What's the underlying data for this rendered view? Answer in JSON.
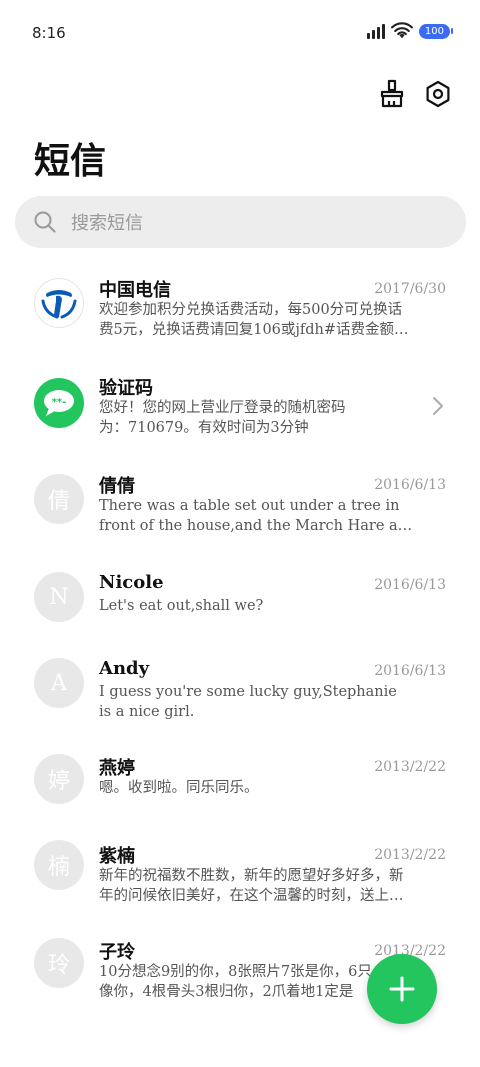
{
  "status_bar": {
    "time": "8:16",
    "battery": "100"
  },
  "header": {
    "title": "短信"
  },
  "search": {
    "placeholder": "搜索短信"
  },
  "messages": [
    {
      "name": "中国电信",
      "date": "2017/6/30",
      "line1": "欢迎参加积分兑换话费活动，每500分可兑换话",
      "line2": "费5元，兑换话费请回复106或jfdh#话费金额…",
      "avatar": "china-telecom-logo"
    },
    {
      "name": "验证码",
      "date": "",
      "line1": "您好！您的网上营业厅登录的随机密码",
      "line2": "为：710679。有效时间为3分钟",
      "avatar": "message-code-icon"
    },
    {
      "name": "倩倩",
      "date": "2016/6/13",
      "line1": "There was a table set out under a tree in",
      "line2": "front of the house,and the March Hare a…",
      "avatar_text": "倩"
    },
    {
      "name": "Nicole",
      "date": "2016/6/13",
      "line1": "Let's eat out,shall we?",
      "line2": "",
      "avatar_text": "N"
    },
    {
      "name": "Andy",
      "date": "2016/6/13",
      "line1": "I guess you're some lucky guy,Stephanie",
      "line2": "is a nice girl.",
      "avatar_text": "A"
    },
    {
      "name": "燕婷",
      "date": "2013/2/22",
      "line1": "嗯。收到啦。同乐同乐。",
      "line2": "",
      "avatar_text": "婷"
    },
    {
      "name": "紫楠",
      "date": "2013/2/22",
      "line1": "新年的祝福数不胜数，新年的愿望好多好多，新",
      "line2": "年的问候依旧美好，在这个温馨的时刻，送上…",
      "avatar_text": "楠"
    },
    {
      "name": "子玲",
      "date": "2013/2/22",
      "line1": "10分想念9别的你，8张照片7张是你，6只",
      "line2": "像你，4根骨头3根归你，2爪着地1定是",
      "avatar_text": "玲"
    }
  ],
  "colors": {
    "accent_green": "#22c55e",
    "battery_blue": "#3b6bf3",
    "telecom_blue": "#0a5bb5"
  }
}
